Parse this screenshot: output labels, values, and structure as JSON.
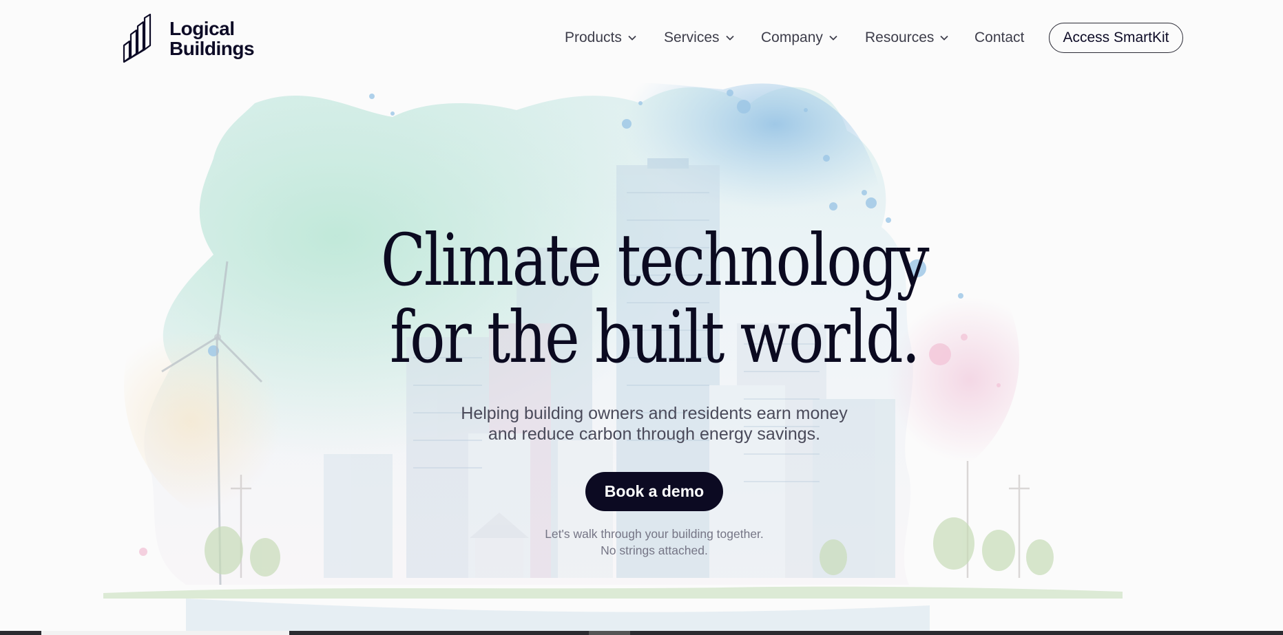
{
  "brand": {
    "name_line1": "Logical",
    "name_line2": "Buildings",
    "logo_icon": "building-bars-logo",
    "color": "#0d0b26"
  },
  "nav": {
    "items": [
      {
        "label": "Products",
        "has_dropdown": true
      },
      {
        "label": "Services",
        "has_dropdown": true
      },
      {
        "label": "Company",
        "has_dropdown": true
      },
      {
        "label": "Resources",
        "has_dropdown": true
      },
      {
        "label": "Contact",
        "has_dropdown": false
      }
    ],
    "cta_label": "Access SmartKit",
    "dropdown_icon": "chevron-down-icon"
  },
  "hero": {
    "title_line1": "Climate technology",
    "title_line2": "for the built world.",
    "subtitle_line1": "Helping building owners and residents earn money",
    "subtitle_line2": "and reduce carbon through energy savings.",
    "cta_label": "Book a demo",
    "note_line1": "Let's walk through your building together.",
    "note_line2": "No strings attached.",
    "illustration": "watercolor-city-skyline",
    "accent_color": "#0c0a22"
  }
}
